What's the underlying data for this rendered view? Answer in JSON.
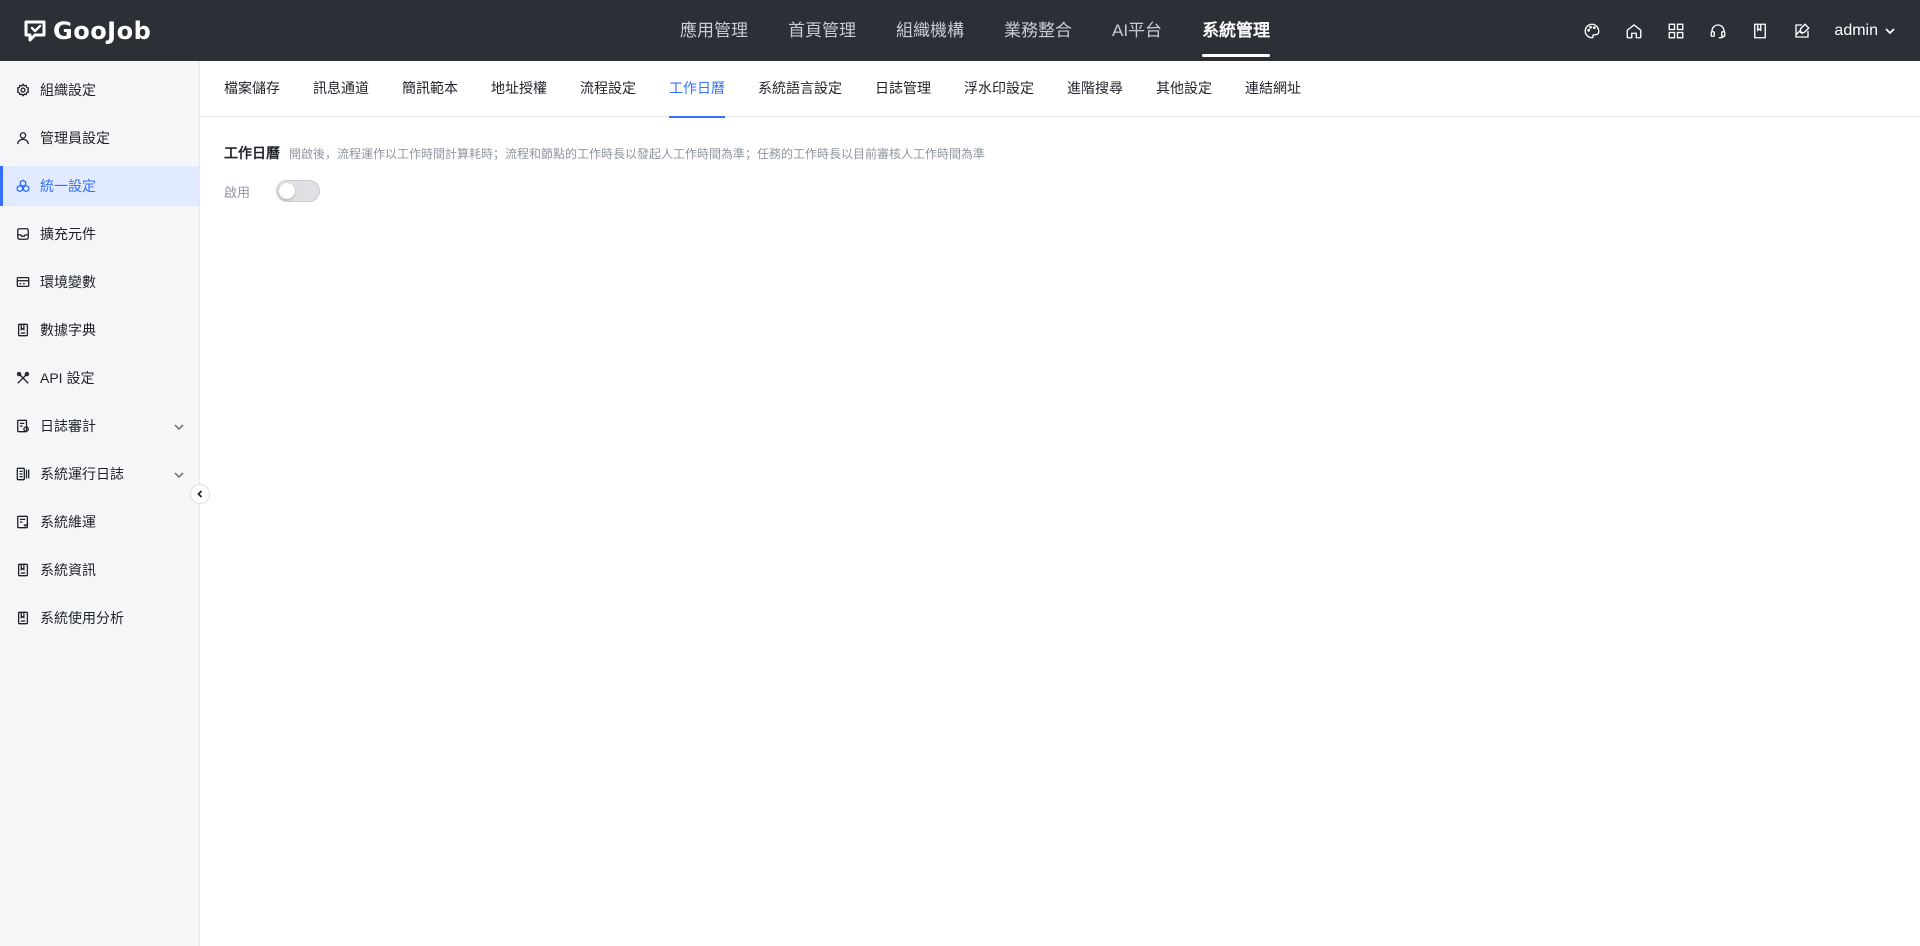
{
  "brand": {
    "name": "GooJob"
  },
  "topnav": {
    "items": [
      {
        "label": "應用管理",
        "active": false
      },
      {
        "label": "首頁管理",
        "active": false
      },
      {
        "label": "組織機構",
        "active": false
      },
      {
        "label": "業務整合",
        "active": false
      },
      {
        "label": "AI平台",
        "active": false
      },
      {
        "label": "系統管理",
        "active": true
      }
    ]
  },
  "header_icons": [
    "palette-icon",
    "home-icon",
    "apps-grid-icon",
    "support-headset-icon",
    "book-icon",
    "edit-image-icon"
  ],
  "user": {
    "name": "admin"
  },
  "sidebar": {
    "items": [
      {
        "label": "組織設定",
        "icon": "gear-icon",
        "active": false,
        "expandable": false
      },
      {
        "label": "管理員設定",
        "icon": "user-icon",
        "active": false,
        "expandable": false
      },
      {
        "label": "統一設定",
        "icon": "cubes-icon",
        "active": true,
        "expandable": false
      },
      {
        "label": "擴充元件",
        "icon": "inbox-icon",
        "active": false,
        "expandable": false
      },
      {
        "label": "環境變數",
        "icon": "card-icon",
        "active": false,
        "expandable": false
      },
      {
        "label": "數據字典",
        "icon": "book-icon",
        "active": false,
        "expandable": false
      },
      {
        "label": "API 設定",
        "icon": "tools-icon",
        "active": false,
        "expandable": false
      },
      {
        "label": "日誌審計",
        "icon": "audit-log-icon",
        "active": false,
        "expandable": true
      },
      {
        "label": "系統運行日誌",
        "icon": "run-log-icon",
        "active": false,
        "expandable": true
      },
      {
        "label": "系統維運",
        "icon": "maintenance-icon",
        "active": false,
        "expandable": false
      },
      {
        "label": "系統資訊",
        "icon": "info-doc-icon",
        "active": false,
        "expandable": false
      },
      {
        "label": "系統使用分析",
        "icon": "analysis-doc-icon",
        "active": false,
        "expandable": false
      }
    ]
  },
  "tabs": [
    {
      "label": "檔案儲存",
      "active": false
    },
    {
      "label": "訊息通道",
      "active": false
    },
    {
      "label": "簡訊範本",
      "active": false
    },
    {
      "label": "地址授權",
      "active": false
    },
    {
      "label": "流程設定",
      "active": false
    },
    {
      "label": "工作日曆",
      "active": true
    },
    {
      "label": "系統語言設定",
      "active": false
    },
    {
      "label": "日誌管理",
      "active": false
    },
    {
      "label": "浮水印設定",
      "active": false
    },
    {
      "label": "進階搜尋",
      "active": false
    },
    {
      "label": "其他設定",
      "active": false
    },
    {
      "label": "連結網址",
      "active": false
    }
  ],
  "work_calendar": {
    "title": "工作日曆",
    "description": "開啟後，流程運作以工作時間計算耗時；流程和節點的工作時長以發起人工作時間為準；任務的工作時長以目前審核人工作時間為準",
    "enable_label": "啟用",
    "enabled": false
  },
  "colors": {
    "accent": "#3370ff",
    "topbar": "#2b2f36",
    "sidebar_bg": "#f5f6f8",
    "active_bg": "#e1eaff"
  }
}
